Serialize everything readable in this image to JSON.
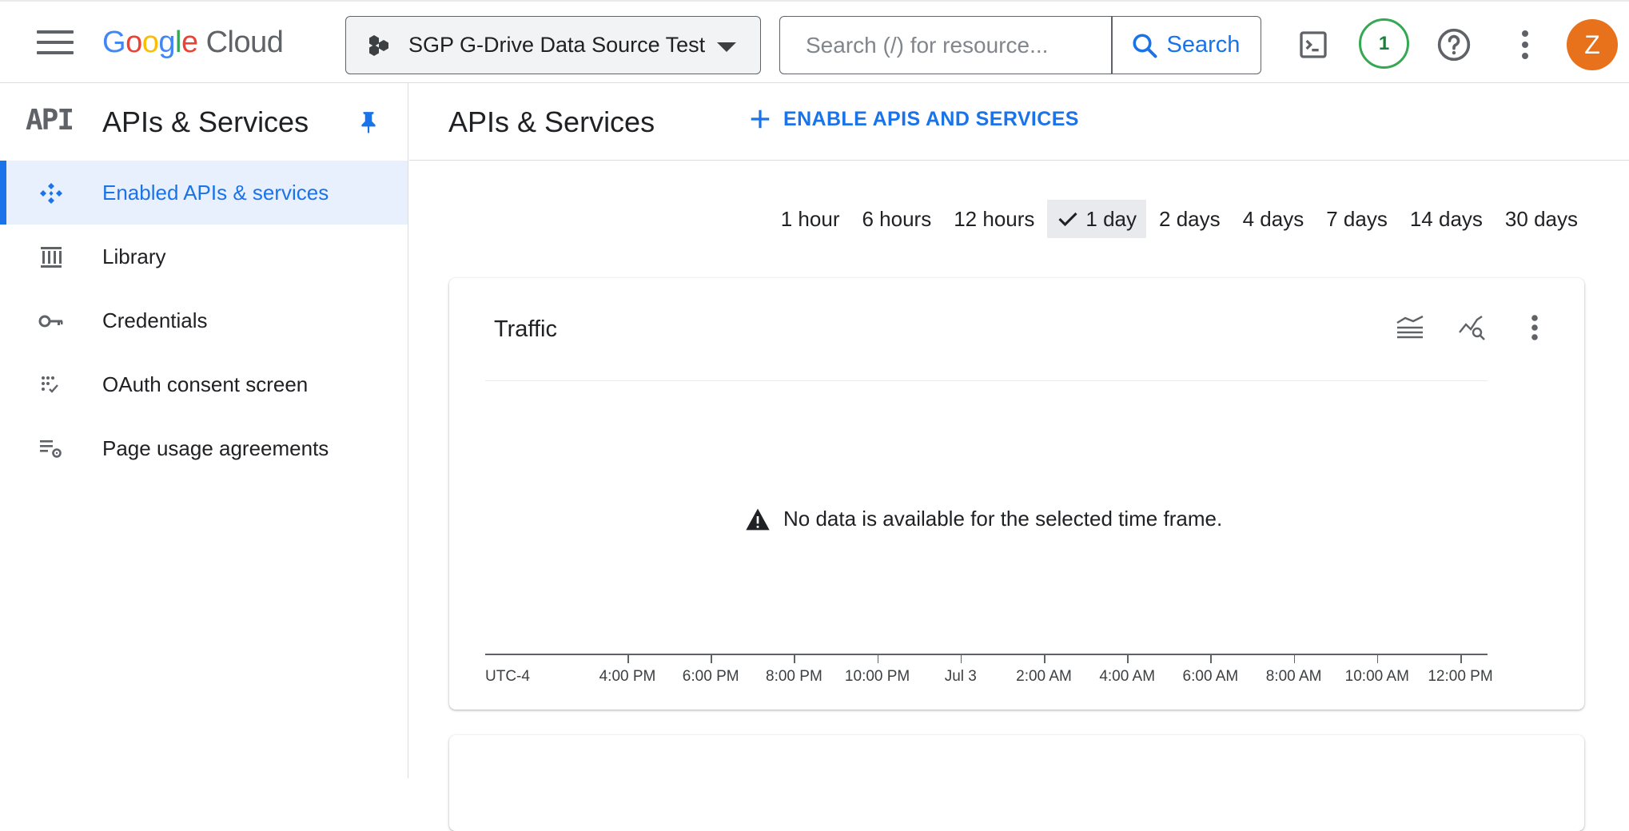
{
  "app": {
    "logo_letters": [
      "G",
      "o",
      "o",
      "g",
      "l",
      "e"
    ],
    "logo_product": "Cloud"
  },
  "topbar": {
    "project_name": "SGP G-Drive Data Source Test",
    "search_placeholder": "Search (/) for resource...",
    "search_button_label": "Search",
    "notification_count": "1",
    "avatar_initial": "Z"
  },
  "sidebar": {
    "badge": "API",
    "title": "APIs & Services",
    "items": [
      {
        "label": "Enabled APIs & services",
        "icon": "apis-diamond-icon",
        "active": true
      },
      {
        "label": "Library",
        "icon": "library-icon",
        "active": false
      },
      {
        "label": "Credentials",
        "icon": "key-icon",
        "active": false
      },
      {
        "label": "OAuth consent screen",
        "icon": "consent-dots-icon",
        "active": false
      },
      {
        "label": "Page usage agreements",
        "icon": "list-settings-icon",
        "active": false
      }
    ]
  },
  "main": {
    "title": "APIs & Services",
    "enable_button_label": "ENABLE APIS AND SERVICES",
    "time_ranges": [
      "1 hour",
      "6 hours",
      "12 hours",
      "1 day",
      "2 days",
      "4 days",
      "7 days",
      "14 days",
      "30 days"
    ],
    "selected_time_range": "1 day",
    "traffic_card": {
      "title": "Traffic",
      "empty_message": "No data is available for the selected time frame.",
      "timezone_label": "UTC-4",
      "x_ticks": [
        "4:00 PM",
        "6:00 PM",
        "8:00 PM",
        "10:00 PM",
        "Jul 3",
        "2:00 AM",
        "4:00 AM",
        "6:00 AM",
        "8:00 AM",
        "10:00 AM",
        "12:00 PM"
      ]
    }
  },
  "colors": {
    "accent": "#1a73e8",
    "avatar": "#e8711c",
    "notification_ring": "#34a853"
  }
}
